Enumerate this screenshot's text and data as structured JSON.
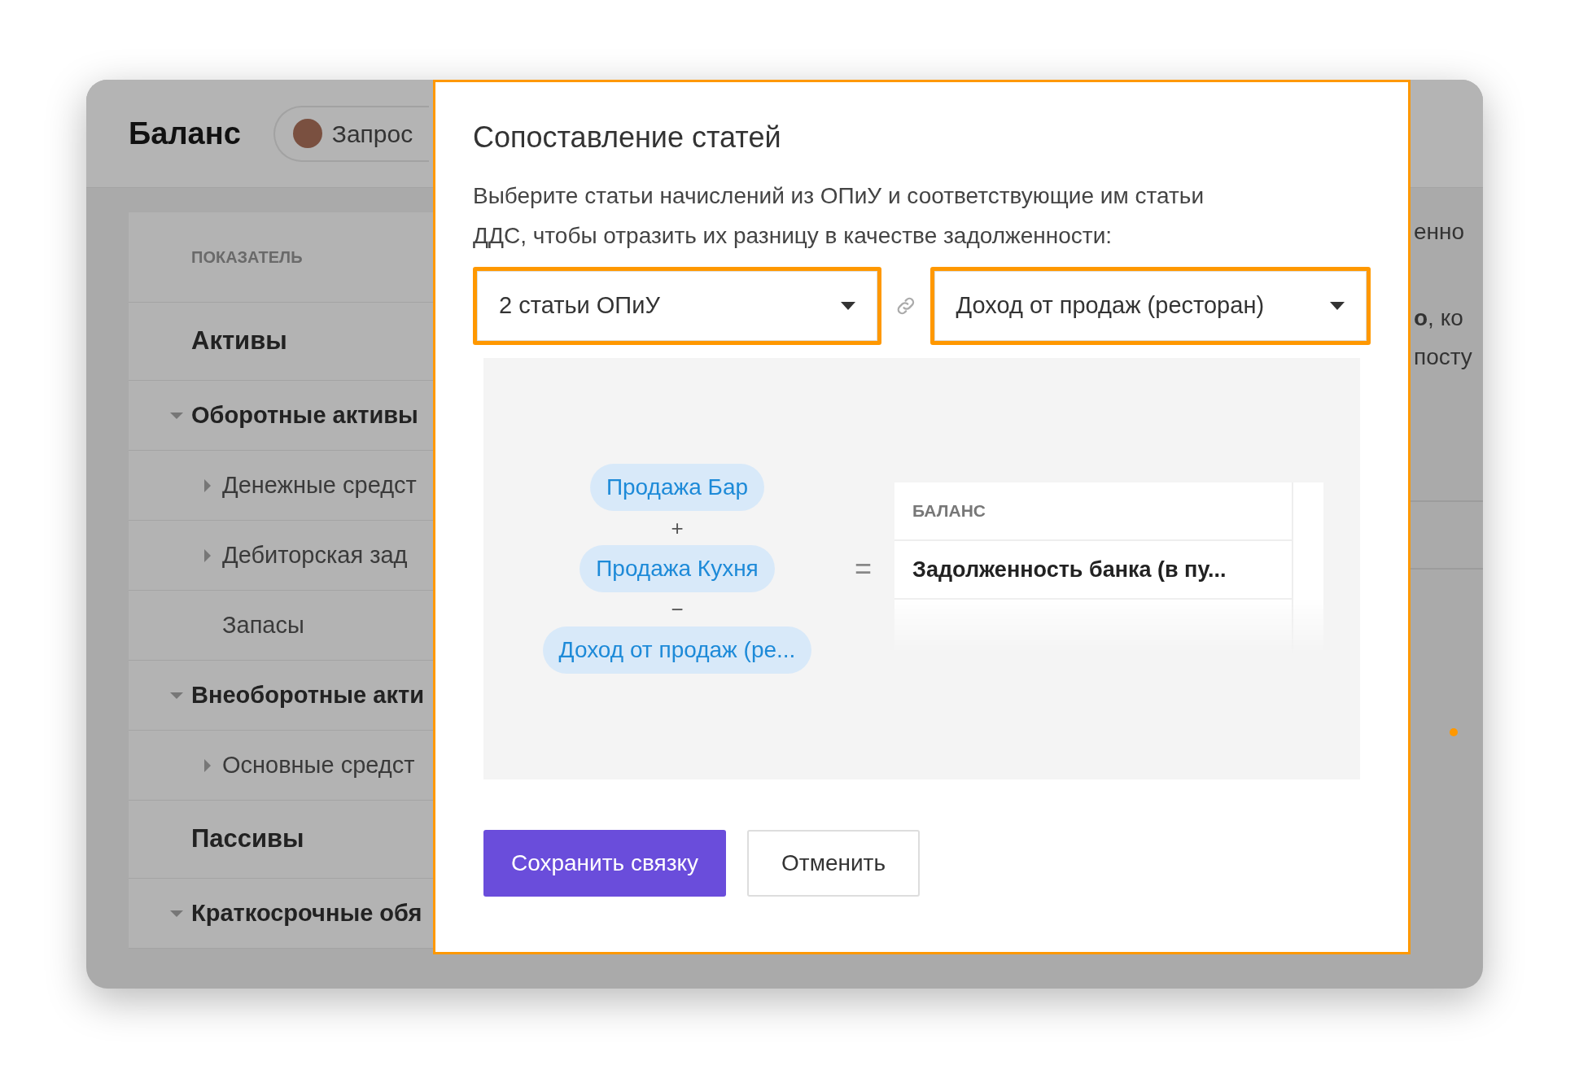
{
  "background": {
    "title": "Баланс",
    "request_pill": {
      "label": "Запрос"
    },
    "table": {
      "column_header": "ПОКАЗАТЕЛЬ",
      "rows": [
        {
          "label": "Активы",
          "kind": "section"
        },
        {
          "label": "Оборотные активы",
          "kind": "group",
          "expanded": true,
          "children": [
            {
              "label": "Денежные средст",
              "kind": "item",
              "expanded": false
            },
            {
              "label": "Дебиторская зад",
              "kind": "item",
              "expanded": false
            },
            {
              "label": "Запасы",
              "kind": "item"
            }
          ]
        },
        {
          "label": "Внеоборотные акти",
          "kind": "group",
          "expanded": true,
          "children": [
            {
              "label": "Основные средст",
              "kind": "item",
              "expanded": false
            }
          ]
        },
        {
          "label": "Пассивы",
          "kind": "section"
        },
        {
          "label": "Краткосрочные обя",
          "kind": "group",
          "expanded": true
        }
      ]
    },
    "right_texts": [
      "енно",
      "**о**, ко",
      "посту"
    ]
  },
  "dialog": {
    "title": "Сопоставление статей",
    "description": "Выберите статьи начислений из ОПиУ и соответствующие им статьи ДДС, чтобы отразить их разницу в качестве задолженности:",
    "selects": [
      {
        "value": "2 статьи ОПиУ",
        "highlighted": true
      },
      {
        "value": "Доход от продаж (ресторан)",
        "highlighted": true
      }
    ],
    "formula": {
      "terms": [
        {
          "kind": "chip",
          "text": "Продажа Бар"
        },
        {
          "kind": "operator",
          "text": "+"
        },
        {
          "kind": "chip",
          "text": "Продажа Кухня"
        },
        {
          "kind": "operator",
          "text": "−"
        },
        {
          "kind": "chip",
          "text": "Доход от продаж (ре..."
        }
      ],
      "equals": "=",
      "result_table": {
        "header": "БАЛАНС",
        "rows": [
          "Задолженность банка (в пу..."
        ]
      }
    },
    "buttons": [
      {
        "label": "Сохранить связку",
        "kind": "primary"
      },
      {
        "label": "Отменить",
        "kind": "secondary"
      }
    ]
  }
}
